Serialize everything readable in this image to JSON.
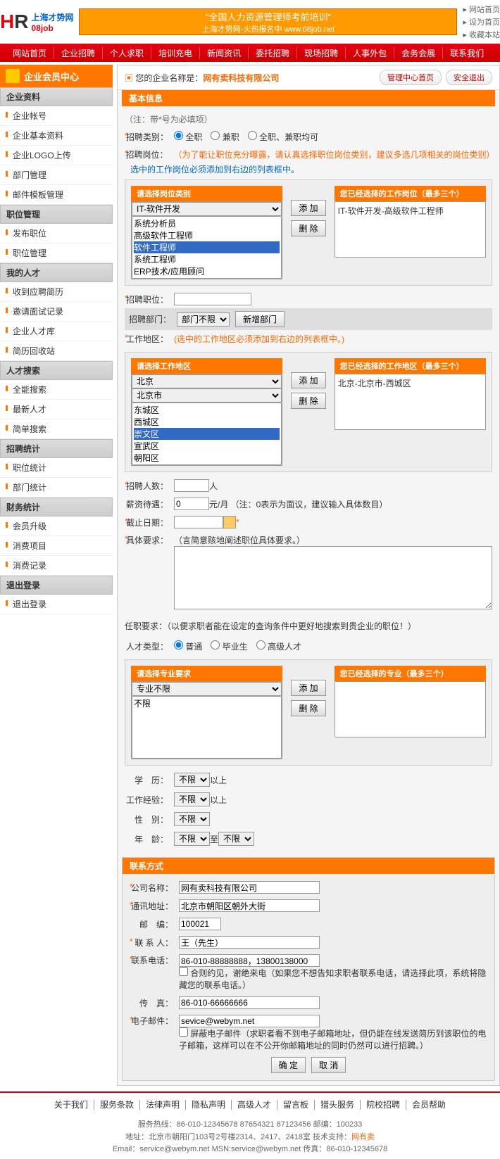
{
  "header": {
    "logo_cn": "上海才势网",
    "logo_en": "08job",
    "banner_line1": "\"全国人力资源管理师考前培训\"",
    "banner_line2": "上海才势网-火热报名中 www.08job.net",
    "top_links": [
      "网站首页",
      "设为首页",
      "收藏本站"
    ]
  },
  "nav": [
    "网站首页",
    "企业招聘",
    "个人求职",
    "培训充电",
    "新闻资讯",
    "委托招聘",
    "现场招聘",
    "人事外包",
    "会务会展",
    "联系我们"
  ],
  "sidebar": {
    "title": "企业会员中心",
    "groups": [
      {
        "title": "企业资料",
        "items": [
          "企业帐号",
          "企业基本资料",
          "企业LOGO上传",
          "部门管理",
          "邮件模板管理"
        ]
      },
      {
        "title": "职位管理",
        "items": [
          "发布职位",
          "职位管理"
        ]
      },
      {
        "title": "我的人才",
        "items": [
          "收到应聘简历",
          "邀请面试记录",
          "企业人才库",
          "简历回收站"
        ]
      },
      {
        "title": "人才搜索",
        "items": [
          "全能搜索",
          "最新人才",
          "简单搜索"
        ]
      },
      {
        "title": "招聘统计",
        "items": [
          "职位统计",
          "部门统计"
        ]
      },
      {
        "title": "财务统计",
        "items": [
          "会员升级",
          "消费项目",
          "消费记录"
        ]
      },
      {
        "title": "退出登录",
        "items": [
          "退出登录"
        ]
      }
    ]
  },
  "content": {
    "company_label": "您的企业名称是：",
    "company_name": "网有卖科技有限公司",
    "btn_home": "管理中心首页",
    "btn_exit": "安全退出",
    "basic_info": "基本信息",
    "note": "（注：带*号为必填项）",
    "recruit_type_label": "招聘类别：",
    "recruit_types": [
      "全职",
      "兼职",
      "全职、兼职均可"
    ],
    "post_cat_label": "招聘岗位：",
    "post_cat_hint": "（为了能让职位充分曝露，请认真选择职位岗位类别，建议多选几项相关的岗位类别）",
    "post_cat_note": "选中的工作岗位必须添加到右边的列表框中。",
    "box_select_cat": "请选择岗位类别",
    "cat_dropdown": "IT-软件开发",
    "cat_options": [
      "系统分析员",
      "高级软件工程师",
      "软件工程师",
      "系统工程师",
      "ERP技术/应用顾问"
    ],
    "cat_options_selected": "软件工程师",
    "box_selected_cat": "您已经选择的工作岗位（最多三个）",
    "selected_cat": "IT-软件开发-高级软件工程师",
    "btn_add": "添 加",
    "btn_del": "删 除",
    "post_name_label": "招聘职位：",
    "dept_label": "招聘部门：",
    "dept_value": "部门不限",
    "btn_new_dept": "新增部门",
    "area_label": "工作地区：",
    "area_hint": "(选中的工作地区必须添加到右边的列表框中。)",
    "box_select_area": "请选择工作地区",
    "area_l1": "北京",
    "area_l2": "北京市",
    "area_options": [
      "东城区",
      "西城区",
      "崇文区",
      "宣武区",
      "朝阳区"
    ],
    "area_options_selected": "崇文区",
    "box_selected_area": "您已经选择的工作地区（最多三个）",
    "selected_area": "北京-北京市-西城区",
    "count_label": "招聘人数：",
    "count_unit": "人",
    "salary_label": "薪资待遇：",
    "salary_value": "0",
    "salary_unit": "元/月 （注：0表示为面议，建议输入具体数目）",
    "deadline_label": "截止日期：",
    "req_label": "具体要求：",
    "req_hint": "（言简意赅地阐述职位具体要求。）",
    "any_req": "任职要求：（以便求职者能在设定的查询条件中更好地搜索到贵企业的职位！）",
    "talent_type_label": "人才类型：",
    "talent_types": [
      "普通",
      "毕业生",
      "高级人才"
    ],
    "box_select_major": "请选择专业要求",
    "major_dropdown": "专业不限",
    "major_options": [
      "不限"
    ],
    "box_selected_major": "您已经选择的专业（最多三个）",
    "edu_label": "学　历：",
    "edu_value": "不限",
    "edu_suffix": "以上",
    "exp_label": "工作经验：",
    "exp_value": "不限",
    "exp_suffix": "以上",
    "gender_label": "性　别：",
    "gender_value": "不限",
    "age_label": "年　龄：",
    "age_from": "不限",
    "age_to_label": "至",
    "age_to": "不限",
    "contact_title": "联系方式",
    "c_company_label": "公司名称：",
    "c_company": "网有卖科技有限公司",
    "c_addr_label": "通讯地址：",
    "c_addr": "北京市朝阳区朝外大街",
    "c_zip_label": "邮　编：",
    "c_zip": "100021",
    "c_contact_label": "联 系 人：",
    "c_contact": "王（先生）",
    "c_phone_label": "联系电话：",
    "c_phone": "86-010-88888888，13800138000",
    "c_phone_chk": "合则约见，谢绝来电（如果您不想告知求职者联系电话，请选择此项，系统将隐藏您的联系电话。）",
    "c_fax_label": "传　真：",
    "c_fax": "86-010-66666666",
    "c_email_label": "电子邮件：",
    "c_email": "sevice@webym.net",
    "c_email_chk": "屏蔽电子邮件（求职者看不到电子邮箱地址，但仍能在线发送简历到该职位的电子邮箱，这样可以在不公开你邮箱地址的同时仍然可以进行招聘。）",
    "btn_ok": "确 定",
    "btn_cancel": "取 消"
  },
  "footer": {
    "nav": [
      "关于我们",
      "服务条款",
      "法律声明",
      "隐私声明",
      "高级人才",
      "留言板",
      "猎头服务",
      "院校招聘",
      "会员帮助"
    ],
    "line1": "服务热线：86-010-12345678 87654321 87123456 邮编：100233",
    "line2_a": "地址：北京市朝阳门103号2号楼2314、2417、2418室 技术支持：",
    "line2_b": "网有卖",
    "line3": "Email：service@webym.net MSN:service@webym.net 传真：86-010-12345678"
  }
}
